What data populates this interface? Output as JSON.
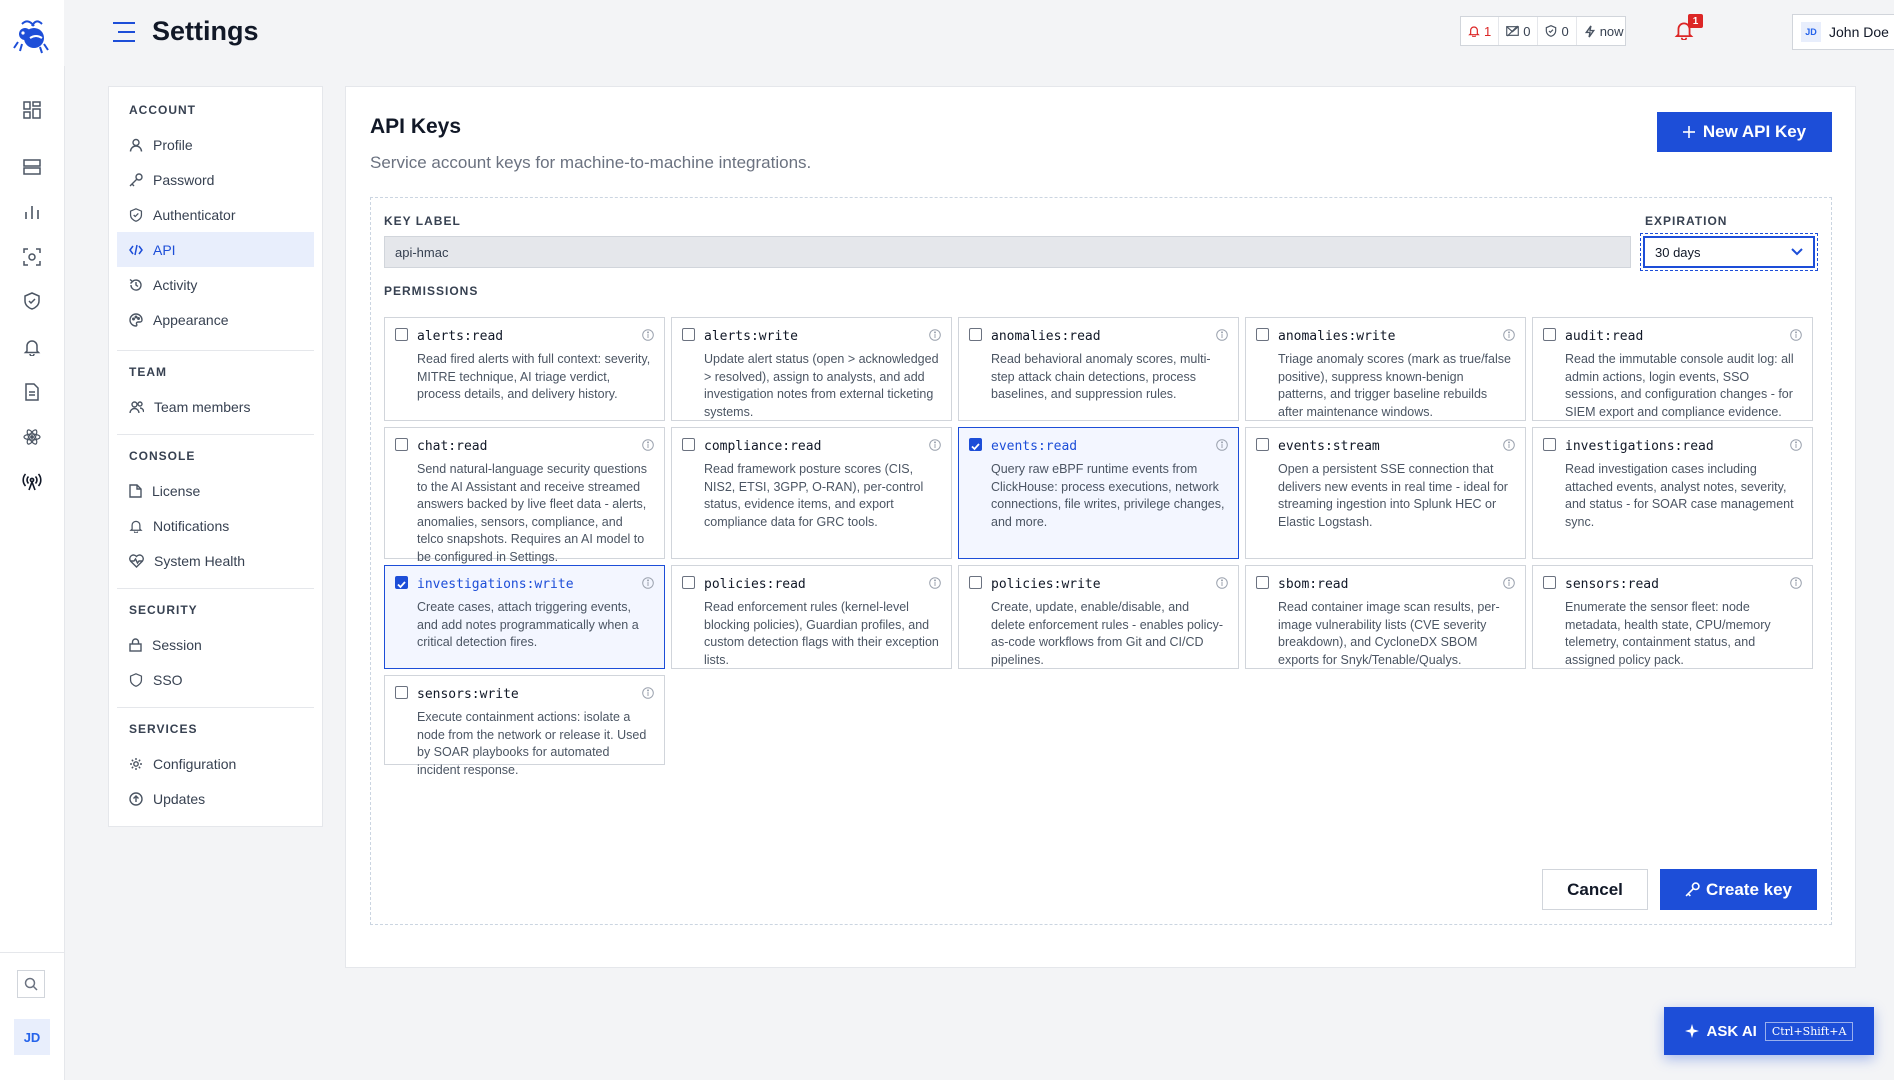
{
  "header": {
    "title": "Settings",
    "status": {
      "alerts": "1",
      "messages": "0",
      "shield": "0",
      "last_sync": "now"
    },
    "notifications_badge": "1",
    "user": {
      "initials": "JD",
      "name": "John Doe"
    }
  },
  "rail": {
    "avatar_initials": "JD"
  },
  "nav": {
    "sections": [
      {
        "title": "ACCOUNT",
        "items": [
          "Profile",
          "Password",
          "Authenticator",
          "API",
          "Activity",
          "Appearance"
        ]
      },
      {
        "title": "TEAM",
        "items": [
          "Team members"
        ]
      },
      {
        "title": "CONSOLE",
        "items": [
          "License",
          "Notifications",
          "System Health"
        ]
      },
      {
        "title": "SECURITY",
        "items": [
          "Session",
          "SSO"
        ]
      },
      {
        "title": "SERVICES",
        "items": [
          "Configuration",
          "Updates"
        ]
      }
    ],
    "active": "API"
  },
  "panel": {
    "title": "API Keys",
    "subtitle": "Service account keys for machine-to-machine integrations.",
    "new_key_label": "New API Key",
    "key_label_heading": "KEY LABEL",
    "key_label_value": "api-hmac",
    "expiration_heading": "EXPIRATION",
    "expiration_value": "30 days",
    "permissions_heading": "PERMISSIONS",
    "permissions": [
      {
        "name": "alerts:read",
        "checked": false,
        "desc": "Read fired alerts with full context: severity, MITRE technique, AI triage verdict, process details, and delivery history."
      },
      {
        "name": "alerts:write",
        "checked": false,
        "desc": "Update alert status (open > acknowledged > resolved), assign to analysts, and add investigation notes from external ticketing systems."
      },
      {
        "name": "anomalies:read",
        "checked": false,
        "desc": "Read behavioral anomaly scores, multi-step attack chain detections, process baselines, and suppression rules."
      },
      {
        "name": "anomalies:write",
        "checked": false,
        "desc": "Triage anomaly scores (mark as true/false positive), suppress known-benign patterns, and trigger baseline rebuilds after maintenance windows."
      },
      {
        "name": "audit:read",
        "checked": false,
        "desc": "Read the immutable console audit log: all admin actions, login events, SSO sessions, and configuration changes - for SIEM export and compliance evidence."
      },
      {
        "name": "chat:read",
        "checked": false,
        "desc": "Send natural-language security questions to the AI Assistant and receive streamed answers backed by live fleet data - alerts, anomalies, sensors, compliance, and telco snapshots. Requires an AI model to be configured in Settings."
      },
      {
        "name": "compliance:read",
        "checked": false,
        "desc": "Read framework posture scores (CIS, NIS2, ETSI, 3GPP, O-RAN), per-control status, evidence items, and export compliance data for GRC tools."
      },
      {
        "name": "events:read",
        "checked": true,
        "desc": "Query raw eBPF runtime events from ClickHouse: process executions, network connections, file writes, privilege changes, and more."
      },
      {
        "name": "events:stream",
        "checked": false,
        "desc": "Open a persistent SSE connection that delivers new events in real time - ideal for streaming ingestion into Splunk HEC or Elastic Logstash."
      },
      {
        "name": "investigations:read",
        "checked": false,
        "desc": "Read investigation cases including attached events, analyst notes, severity, and status - for SOAR case management sync."
      },
      {
        "name": "investigations:write",
        "checked": true,
        "desc": "Create cases, attach triggering events, and add notes programmatically when a critical detection fires."
      },
      {
        "name": "policies:read",
        "checked": false,
        "desc": "Read enforcement rules (kernel-level blocking policies), Guardian profiles, and custom detection flags with their exception lists."
      },
      {
        "name": "policies:write",
        "checked": false,
        "desc": "Create, update, enable/disable, and delete enforcement rules - enables policy-as-code workflows from Git and CI/CD pipelines."
      },
      {
        "name": "sbom:read",
        "checked": false,
        "desc": "Read container image scan results, per-image vulnerability lists (CVE severity breakdown), and CycloneDX SBOM exports for Snyk/Tenable/Qualys."
      },
      {
        "name": "sensors:read",
        "checked": false,
        "desc": "Enumerate the sensor fleet: node metadata, health state, CPU/memory telemetry, containment status, and assigned policy pack."
      },
      {
        "name": "sensors:write",
        "checked": false,
        "desc": "Execute containment actions: isolate a node from the network or release it. Used by SOAR playbooks for automated incident response."
      }
    ],
    "cancel_label": "Cancel",
    "create_label": "Create key"
  },
  "ask_ai": {
    "label": "ASK AI",
    "shortcut": "Ctrl+Shift+A"
  },
  "colors": {
    "accent": "#1d4ed8",
    "alert": "#dc2626",
    "active_bg": "#e8eefc"
  },
  "icons": {
    "rail": [
      "dashboard-icon",
      "server-icon",
      "chart-icon",
      "scan-icon",
      "shield-icon",
      "bell-icon",
      "document-icon",
      "atom-icon",
      "broadcast-icon"
    ],
    "nav": [
      "user-icon",
      "key-icon",
      "shield-check-icon",
      "code-icon",
      "history-icon",
      "palette-icon",
      "users-icon",
      "file-icon",
      "bell-icon",
      "heart-pulse-icon",
      "lock-icon",
      "shield-icon",
      "gear-icon",
      "upload-circle-icon"
    ]
  }
}
